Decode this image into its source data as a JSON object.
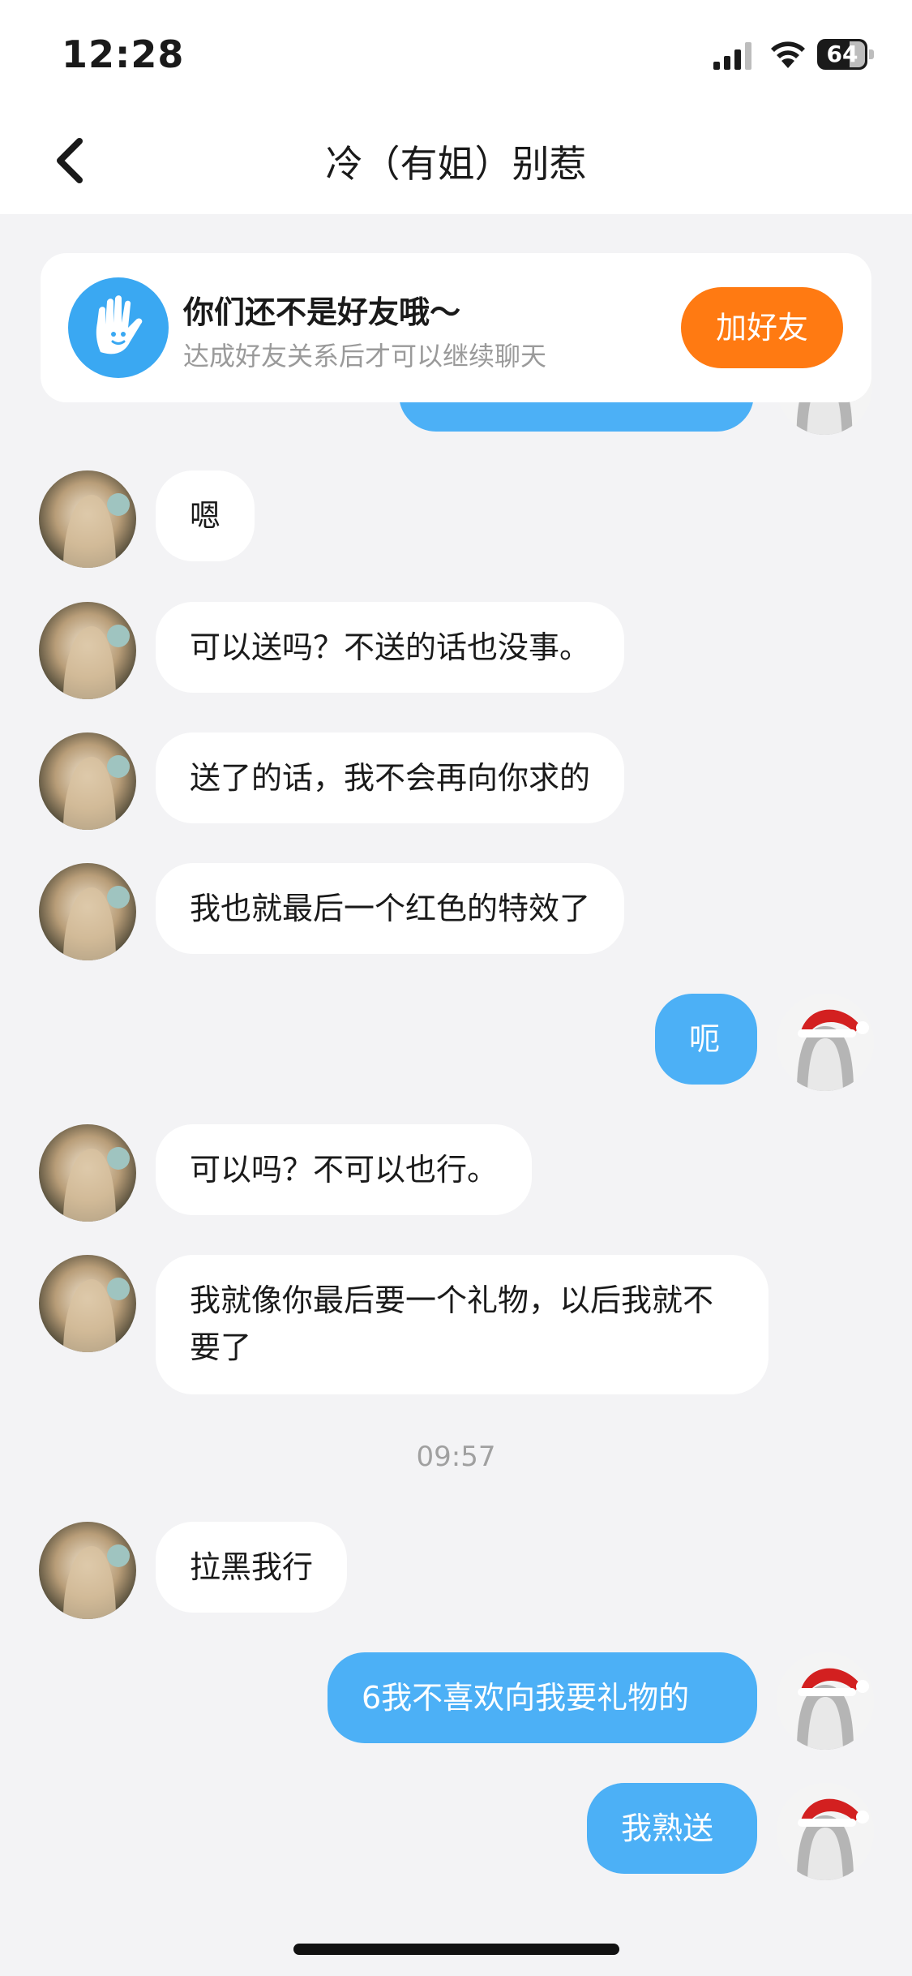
{
  "status_bar": {
    "time": "12:28",
    "battery": "64"
  },
  "nav": {
    "title": "冷（有姐）别惹"
  },
  "banner": {
    "title": "你们还不是好友哦～",
    "subtitle": "达成好友关系后才可以继续聊天",
    "button_label": "加好友"
  },
  "messages": [
    {
      "side": "in",
      "text": "嗯"
    },
    {
      "side": "in",
      "text": "可以送吗？不送的话也没事。"
    },
    {
      "side": "in",
      "text": "送了的话，我不会再向你求的"
    },
    {
      "side": "in",
      "text": "我也就最后一个红色的特效了"
    },
    {
      "side": "out",
      "text": "呃"
    },
    {
      "side": "in",
      "text": "可以吗？不可以也行。"
    },
    {
      "side": "in",
      "text": "我就像你最后要一个礼物，以后我就不要了"
    },
    {
      "side": "in",
      "text": "拉黑我行"
    },
    {
      "side": "out",
      "text": "6我不喜欢向我要礼物的"
    },
    {
      "side": "out",
      "text": "我熟送"
    }
  ],
  "timestamp": "09:57",
  "colors": {
    "outgoing_bubble": "#4cb0f6",
    "incoming_bubble": "#ffffff",
    "add_friend": "#ff7a12",
    "background": "#f3f3f5"
  }
}
